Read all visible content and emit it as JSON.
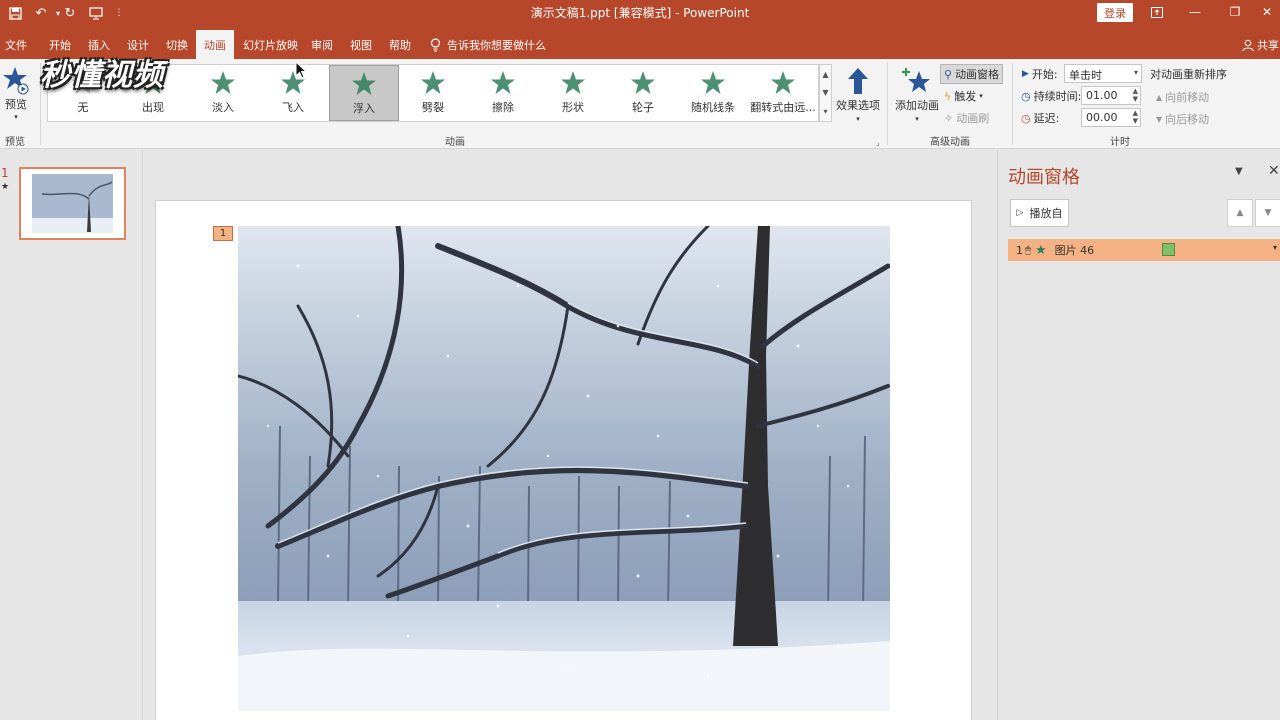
{
  "window": {
    "title": "演示文稿1.ppt [兼容模式] - PowerPoint",
    "login": "登录"
  },
  "tabs": [
    {
      "label": "文件"
    },
    {
      "label": "开始"
    },
    {
      "label": "插入"
    },
    {
      "label": "设计"
    },
    {
      "label": "切换"
    },
    {
      "label": "动画"
    },
    {
      "label": "幻灯片放映"
    },
    {
      "label": "审阅"
    },
    {
      "label": "视图"
    },
    {
      "label": "帮助"
    }
  ],
  "active_tab": "动画",
  "tell_me": "告诉我你想要做什么",
  "share": "共享",
  "ribbon": {
    "preview": {
      "button": "预览",
      "group": "预览"
    },
    "animations": [
      {
        "label": "无"
      },
      {
        "label": "出现"
      },
      {
        "label": "淡入"
      },
      {
        "label": "飞入"
      },
      {
        "label": "浮入"
      },
      {
        "label": "劈裂"
      },
      {
        "label": "擦除"
      },
      {
        "label": "形状"
      },
      {
        "label": "轮子"
      },
      {
        "label": "随机线条"
      },
      {
        "label": "翻转式由远..."
      }
    ],
    "selected_animation": "浮入",
    "effect_options": "效果选项",
    "animation_group": "动画",
    "advanced": {
      "add_animation": "添加动画",
      "animation_pane": "动画窗格",
      "trigger": "触发",
      "animation_painter": "动画刷",
      "group": "高级动画"
    },
    "timing": {
      "start_label": "开始:",
      "start_value": "单击时",
      "duration_label": "持续时间:",
      "duration_value": "01.00",
      "delay_label": "延迟:",
      "delay_value": "00.00",
      "reorder_title": "对动画重新排序",
      "move_earlier": "向前移动",
      "move_later": "向后移动",
      "group": "计时"
    }
  },
  "watermark": "秒懂视频",
  "slides": [
    {
      "number": "1",
      "marker": "★"
    }
  ],
  "slide": {
    "animation_tag": "1"
  },
  "pane": {
    "title": "动画窗格",
    "play_from": "播放自",
    "items": [
      {
        "order": "1",
        "name": "图片 46"
      }
    ]
  },
  "colors": {
    "accent": "#b7472a",
    "selection": "#f4b183",
    "effect_star": "#2e7d5b"
  }
}
